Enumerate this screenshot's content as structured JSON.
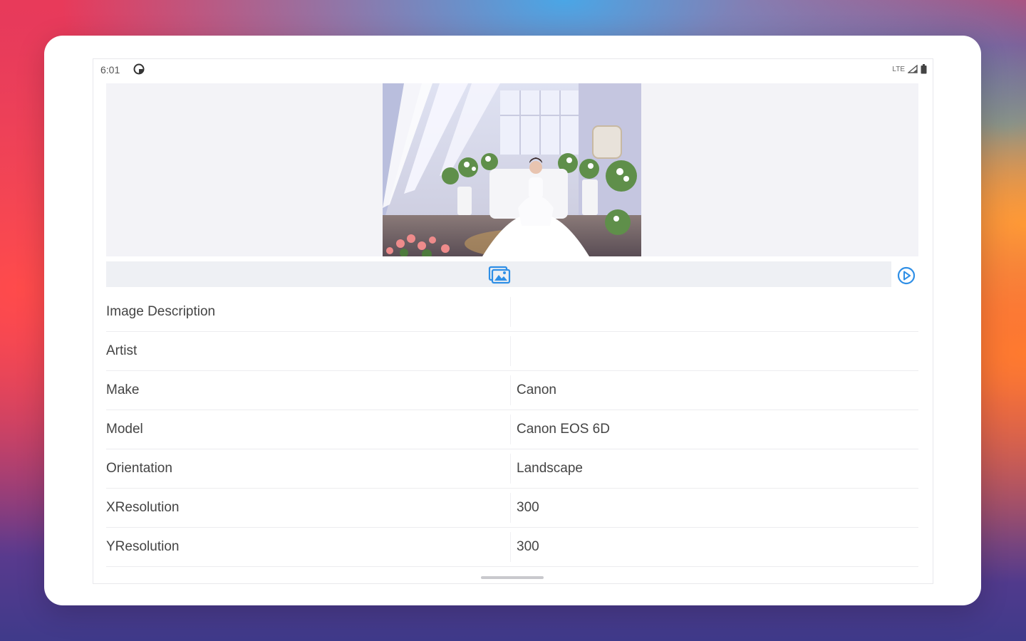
{
  "status": {
    "time": "6:01",
    "network": "LTE"
  },
  "icons": {
    "status_app": "g-circle-icon",
    "signal": "signal-icon",
    "battery": "battery-icon",
    "gallery": "image-gallery-icon",
    "play": "play-circle-icon"
  },
  "accent_color": "#2f8fe6",
  "exif": {
    "rows": [
      {
        "key": "Image Description",
        "value": ""
      },
      {
        "key": "Artist",
        "value": ""
      },
      {
        "key": "Make",
        "value": "Canon"
      },
      {
        "key": "Model",
        "value": "Canon EOS 6D"
      },
      {
        "key": "Orientation",
        "value": "Landscape"
      },
      {
        "key": "XResolution",
        "value": "300"
      },
      {
        "key": "YResolution",
        "value": "300"
      }
    ]
  }
}
